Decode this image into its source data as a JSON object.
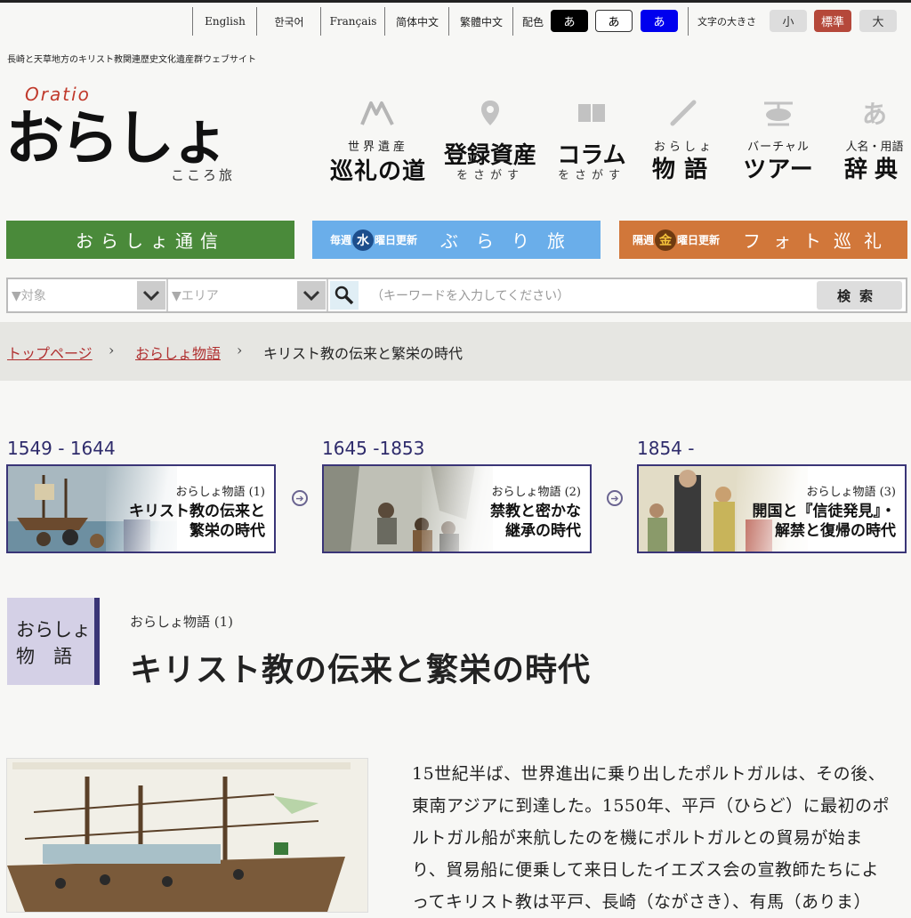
{
  "languages": [
    "English",
    "한국어",
    "Français",
    "简体中文",
    "繁體中文"
  ],
  "color_scheme": {
    "label": "配色",
    "options": [
      {
        "text": "あ",
        "bg": "#000000",
        "fg": "#ffffff"
      },
      {
        "text": "あ",
        "bg": "#ffffff",
        "fg": "#000000"
      },
      {
        "text": "あ",
        "bg": "#0000ee",
        "fg": "#ffffff"
      }
    ]
  },
  "font_size": {
    "label": "文字の大きさ",
    "options": [
      {
        "text": "小",
        "active": false
      },
      {
        "text": "標準",
        "active": true,
        "active_color": "#b5483a"
      },
      {
        "text": "大",
        "active": false
      }
    ]
  },
  "tagline": "長崎と天草地方のキリスト教関連歴史文化遺産群ウェブサイト",
  "logo": {
    "latin": "Oratio",
    "main": "おらしょ",
    "sub": "こころ旅"
  },
  "nav": [
    {
      "small": "世界遺産",
      "big": "巡礼の道",
      "icon": "pilgrim-path-icon"
    },
    {
      "big": "登録資産",
      "small": "をさがす",
      "icon": "map-pin-icon"
    },
    {
      "big": "コラム",
      "small": "をさがす",
      "icon": "book-icon"
    },
    {
      "small": "おらしょ",
      "big": "物語",
      "icon": "quill-icon"
    },
    {
      "small": "バーチャル",
      "big": "ツアー",
      "icon": "helicopter-icon"
    },
    {
      "small": "人名・用語",
      "big": "辞典",
      "icon": "dictionary-a-icon"
    }
  ],
  "banners": {
    "b1": {
      "label": "おらしょ通信",
      "color": "#4a8a3a"
    },
    "b2": {
      "pre_a": "毎週",
      "pre_day": "水",
      "pre_b": "曜日更新",
      "label": "ぶらり旅",
      "color": "#6aaeea"
    },
    "b3": {
      "pre_a": "隔週",
      "pre_day": "金",
      "pre_b": "曜日更新",
      "label": "フォト巡礼",
      "color": "#d1773a"
    }
  },
  "search": {
    "target_placeholder": "▼対象",
    "area_placeholder": "▼エリア",
    "keyword_placeholder": "（キーワードを入力してください）",
    "button": "検索"
  },
  "breadcrumb": {
    "home": "トップページ",
    "parent": "おらしょ物語",
    "current": "キリスト教の伝来と繁栄の時代"
  },
  "timeline": [
    {
      "era": "1549 - 1644",
      "sub": "おらしょ物語 (1)",
      "title1": "キリスト教の伝来と",
      "title2": "繁栄の時代"
    },
    {
      "era": "1645 -1853",
      "sub": "おらしょ物語 (2)",
      "title1": "禁教と密かな",
      "title2": "継承の時代"
    },
    {
      "era": "1854 -",
      "sub": "おらしょ物語 (3)",
      "title1": "開国と『信徒発見』・",
      "title2": "解禁と復帰の時代"
    }
  ],
  "section": {
    "tag1": "おらしょ",
    "tag2": "物　語",
    "subtitle": "おらしょ物語 (1)",
    "title": "キリスト教の伝来と繁栄の時代"
  },
  "article": {
    "lines": [
      "15世紀半ば、世界進出に乗り出したポルトガルは、その後、",
      "東南アジアに到達した。1550年、平戸（ひらど）に最初のポ",
      "ルトガル船が来航したのを機にポルトガルとの貿易が始ま",
      "り、貿易船に便乗して来日したイエズス会の宣教師たちによ",
      "ってキリスト教は平戸、長崎（ながさき）、有馬（ありま）"
    ]
  }
}
